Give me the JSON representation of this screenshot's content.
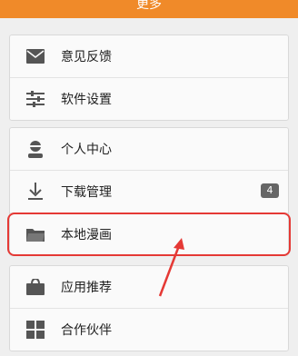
{
  "header": {
    "title": "更多"
  },
  "groups": [
    {
      "items": [
        {
          "label": "意见反馈",
          "icon": "mail-icon"
        },
        {
          "label": "软件设置",
          "icon": "sliders-icon"
        }
      ]
    },
    {
      "items": [
        {
          "label": "个人中心",
          "icon": "person-icon"
        },
        {
          "label": "下载管理",
          "icon": "download-icon",
          "badge": "4"
        },
        {
          "label": "本地漫画",
          "icon": "folder-icon"
        }
      ]
    },
    {
      "items": [
        {
          "label": "应用推荐",
          "icon": "bag-icon"
        },
        {
          "label": "合作伙伴",
          "icon": "grid-icon"
        }
      ]
    }
  ],
  "colors": {
    "header": "#f08a29",
    "highlight": "#e53935",
    "icon": "#555555"
  }
}
